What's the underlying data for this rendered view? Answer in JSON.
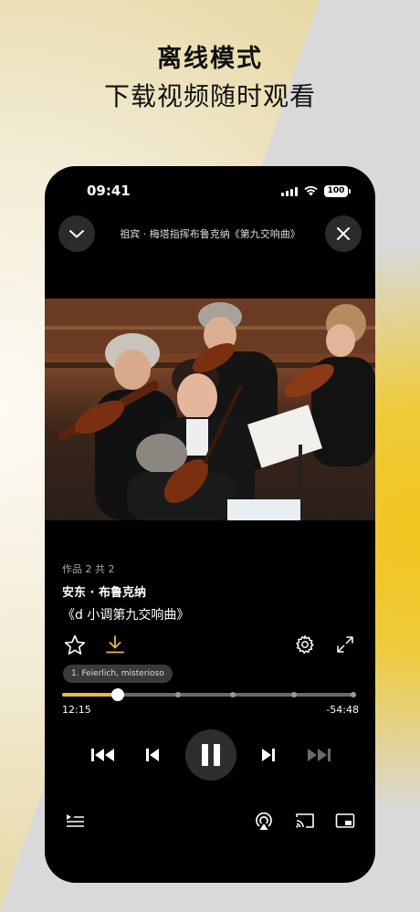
{
  "promo": {
    "headline": "离线模式",
    "subheadline": "下载视频随时观看"
  },
  "status_bar": {
    "time": "09:41",
    "battery": "100"
  },
  "player": {
    "title": "祖宾 · 梅塔指挥布鲁克纳《第九交响曲》",
    "work_count": "作品 2 共 2",
    "composer": "安东 · 布鲁克纳",
    "work": "《d 小调第九交响曲》",
    "movement": "1. Feierlich, misterioso",
    "elapsed": "12:15",
    "remaining": "-54:48",
    "progress_fraction": 0.19,
    "accent_color": "#e8b84a"
  },
  "icons": {
    "close": "chevron-down-icon",
    "dismiss": "close-icon",
    "favorite": "star-icon",
    "download": "download-icon",
    "settings": "gear-icon",
    "fullscreen": "expand-icon",
    "skip_back": "skip-back-icon",
    "prev": "previous-icon",
    "pause": "pause-icon",
    "next": "next-icon",
    "skip_forward": "skip-forward-icon",
    "playlist": "playlist-icon",
    "airplay": "airplay-icon",
    "cast": "cast-icon",
    "pip": "picture-in-picture-icon"
  }
}
